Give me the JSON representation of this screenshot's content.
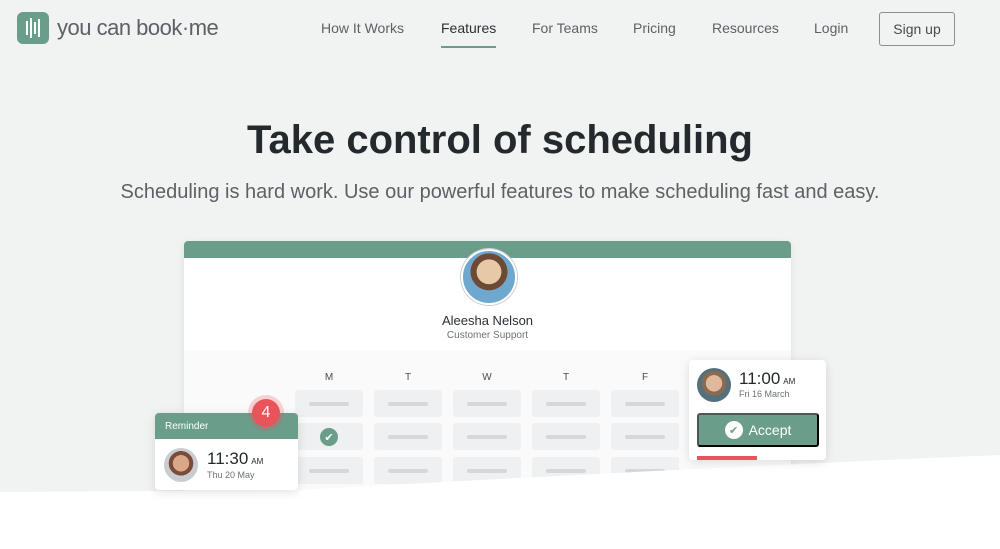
{
  "brand": {
    "name": "you can book·me",
    "color": "#6a9e8b"
  },
  "nav": {
    "links": [
      "How It Works",
      "Features",
      "For Teams",
      "Pricing",
      "Resources",
      "Login"
    ],
    "active": "Features",
    "signup": "Sign up"
  },
  "hero": {
    "title": "Take control of scheduling",
    "subtitle": "Scheduling is hard work. Use our powerful features to make scheduling fast and easy."
  },
  "profile": {
    "name": "Aleesha Nelson",
    "role": "Customer Support"
  },
  "calendar": {
    "days": [
      "M",
      "T",
      "W",
      "T",
      "F"
    ]
  },
  "reminder": {
    "label": "Reminder",
    "badge": "4",
    "time": "11:30",
    "ampm": "AM",
    "date": "Thu 20 May"
  },
  "booking": {
    "time": "11:00",
    "ampm": "AM",
    "date": "Fri 16 March",
    "accept": "Accept"
  },
  "colors": {
    "accent": "#6a9e8b",
    "alert": "#e8545a"
  }
}
